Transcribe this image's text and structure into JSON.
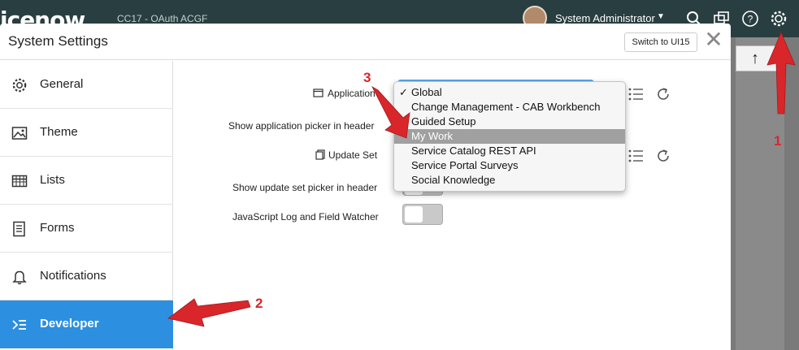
{
  "topbar": {
    "logo_text": "icenow",
    "instance_label": "CC17 - OAuth ACGF",
    "user_name": "System Administrator",
    "icons": [
      "search-icon",
      "connect-chat-icon",
      "help-icon",
      "settings-gear-icon"
    ]
  },
  "background": {
    "up_arrow": "↑"
  },
  "modal": {
    "title": "System Settings",
    "switch_label": "Switch to UI15",
    "close_glyph": "✕"
  },
  "sidebar": {
    "items": [
      {
        "label": "General",
        "icon": "gear-icon"
      },
      {
        "label": "Theme",
        "icon": "image-icon"
      },
      {
        "label": "Lists",
        "icon": "table-list-icon"
      },
      {
        "label": "Forms",
        "icon": "form-icon"
      },
      {
        "label": "Notifications",
        "icon": "bell-icon"
      },
      {
        "label": "Developer",
        "icon": "developer-icon",
        "active": true
      }
    ]
  },
  "form": {
    "application_label": "Application",
    "app_picker_label": "Show application picker in header",
    "update_set_label": "Update Set",
    "update_set_picker_label": "Show update set picker in header",
    "js_log_label": "JavaScript Log and Field Watcher"
  },
  "dropdown": {
    "options": [
      "Global",
      "Change Management - CAB Workbench",
      "Guided Setup",
      "My Work",
      "Service Catalog REST API",
      "Service Portal Surveys",
      "Social Knowledge"
    ],
    "checked": "Global",
    "highlighted": "My Work"
  },
  "annotations": {
    "step1": "1",
    "step2": "2",
    "step3": "3"
  },
  "colors": {
    "topbar": "#293e40",
    "active": "#2d8fe0",
    "annotation": "#d8262b"
  }
}
